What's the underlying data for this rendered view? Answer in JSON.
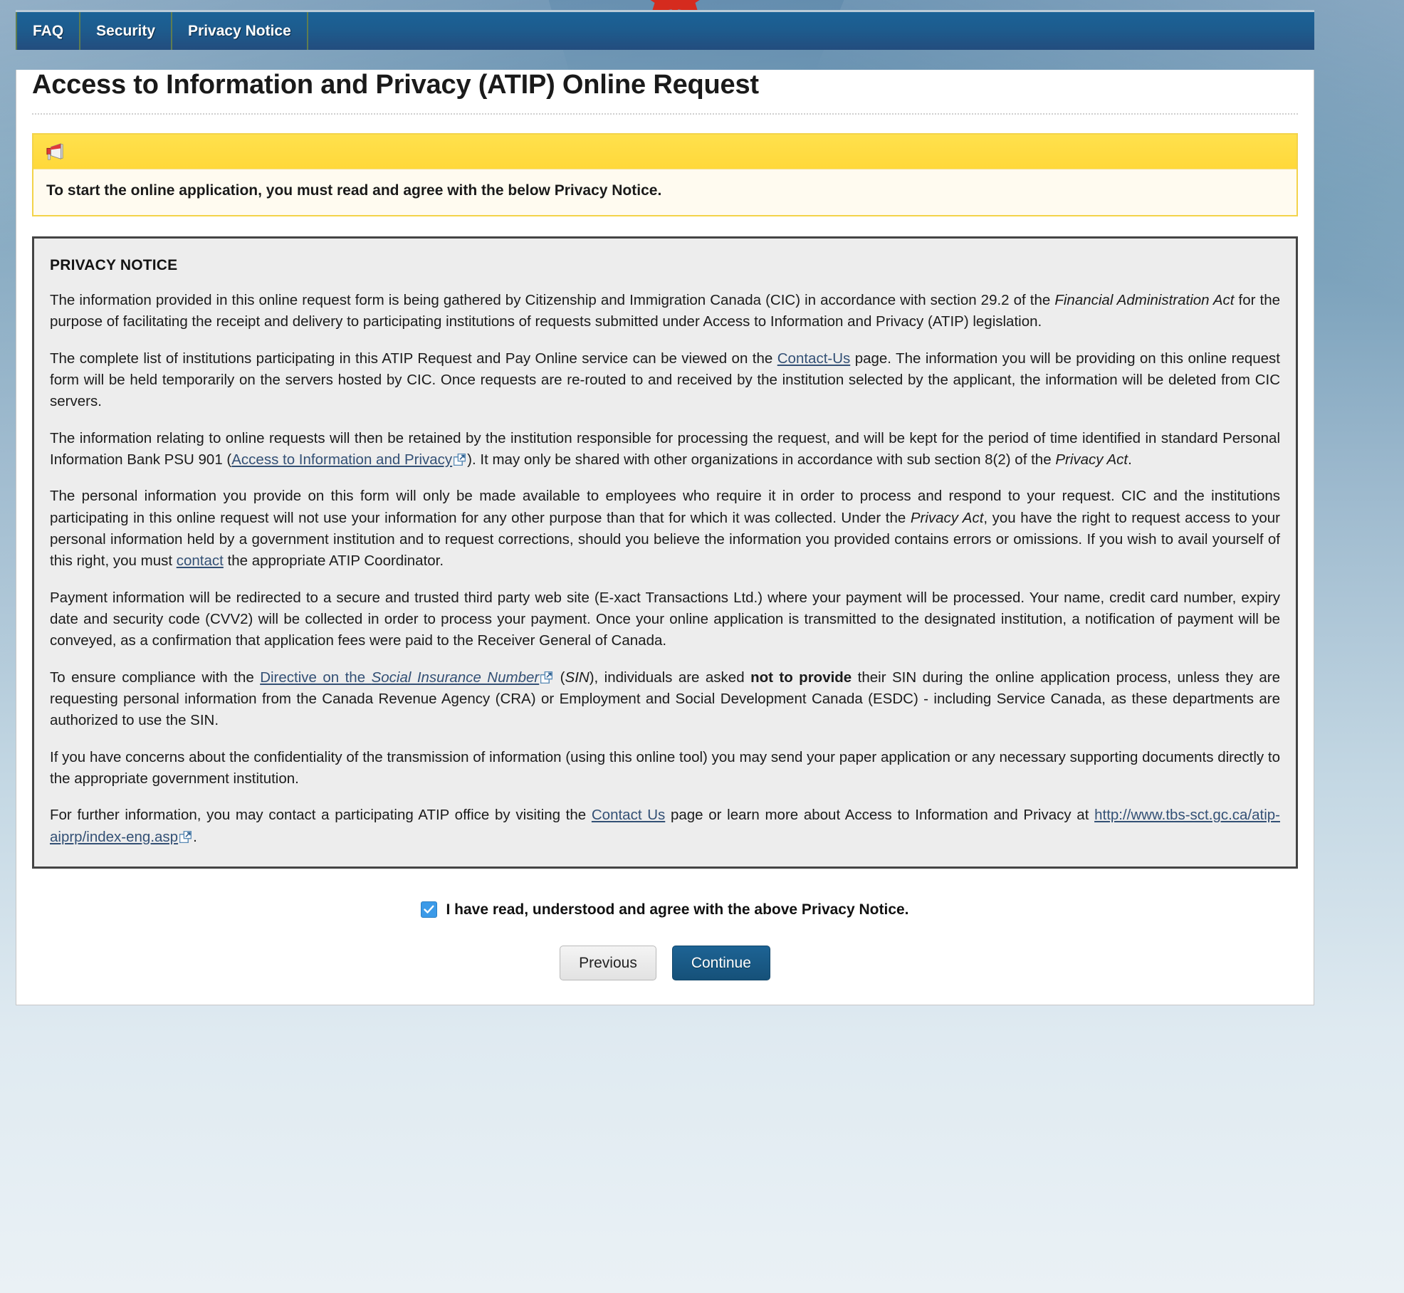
{
  "nav": {
    "tabs": [
      {
        "label": "FAQ"
      },
      {
        "label": "Security"
      },
      {
        "label": "Privacy Notice"
      }
    ]
  },
  "page": {
    "title": "Access to Information and Privacy (ATIP) Online Request"
  },
  "alert": {
    "icon": "megaphone-icon",
    "message": "To start the online application, you must read and agree with the below Privacy Notice."
  },
  "notice": {
    "heading": "PRIVACY NOTICE",
    "paragraph_1": {
      "part_1": "The information provided in this online request form is being gathered by Citizenship and Immigration Canada (CIC) in accordance with section 29.2 of the ",
      "italic_1": "Financial Administration Act",
      "part_2": " for the purpose of facilitating the receipt and delivery to participating institutions of requests submitted under Access to Information and Privacy (ATIP) legislation."
    },
    "paragraph_2": {
      "part_1": "The complete list of institutions participating in this ATIP Request and Pay Online service can be viewed on the ",
      "link_1": "Contact-Us",
      "part_2": " page. The information you will be providing on this online request form will be held temporarily on the servers hosted by CIC. Once requests are re-routed to and received by the institution selected by the applicant, the information will be deleted from CIC servers."
    },
    "paragraph_3": {
      "part_1": "The information relating to online requests will then be retained by the institution responsible for processing the request, and will be kept for the period of time identified in standard Personal Information Bank PSU 901 (",
      "link_1": "Access to Information and Privacy",
      "part_2": "). It may only be shared with other organizations in accordance with sub section 8(2) of the ",
      "italic_1": "Privacy Act",
      "part_3": "."
    },
    "paragraph_4": {
      "part_1": "The personal information you provide on this form will only be made available to employees who require it in order to process and respond to your request. CIC and the institutions participating in this online request will not use your information for any other purpose than that for which it was collected. Under the ",
      "italic_1": "Privacy Act",
      "part_2": ", you have the right to request access to your personal information held by a government institution and to request corrections, should you believe the information you provided contains errors or omissions. If you wish to avail yourself of this right, you must ",
      "link_1": "contact",
      "part_3": " the appropriate ATIP Coordinator."
    },
    "paragraph_5": "Payment information will be redirected to a secure and trusted third party web site (E-xact Transactions Ltd.) where your payment will be processed. Your name, credit card number, expiry date and security code (CVV2) will be collected in order to process your payment. Once your online application is transmitted to the designated institution, a notification of payment will be conveyed, as a confirmation that application fees were paid to the Receiver General of Canada.",
    "paragraph_6": {
      "part_1": "To ensure compliance with the ",
      "link_1_plain": "Directive on the ",
      "link_1_italic": "Social Insurance Number",
      "part_2": " (",
      "italic_1": "SIN",
      "part_3": "), individuals are asked ",
      "bold_1": "not to provide",
      "part_4": " their SIN during the online application process, unless they are requesting personal information from the Canada Revenue Agency (CRA) or Employment and Social Development Canada (ESDC) - including Service Canada, as these departments are authorized to use the SIN."
    },
    "paragraph_7": "If you have concerns about the confidentiality of the transmission of information (using this online tool) you may send your paper application or any necessary supporting documents directly to the appropriate government institution.",
    "paragraph_8": {
      "part_1": "For further information, you may contact a participating ATIP office by visiting the ",
      "link_1": "Contact Us",
      "part_2": " page or learn more about Access to Information and Privacy at ",
      "link_2": "http://www.tbs-sct.gc.ca/atip-aiprp/index-eng.asp",
      "part_3": "."
    }
  },
  "agreement": {
    "label": "I have read, understood and agree with the above Privacy Notice.",
    "checked": "true"
  },
  "buttons": {
    "previous": "Previous",
    "continue": "Continue"
  },
  "colors": {
    "nav_blue": "#1d5c8e",
    "alert_yellow": "#ffd83a",
    "alert_bg": "#fffbf0",
    "link_blue": "#335075",
    "checkbox_blue": "#3b9ae8",
    "continue_blue": "#1d6394",
    "notice_bg": "#ededed"
  }
}
